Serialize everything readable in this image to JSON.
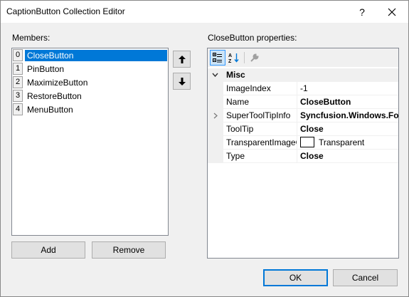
{
  "window": {
    "title": "CaptionButton Collection Editor",
    "help_glyph": "?"
  },
  "members": {
    "label": "Members:",
    "items": [
      {
        "index": "0",
        "name": "CloseButton",
        "selected": true
      },
      {
        "index": "1",
        "name": "PinButton"
      },
      {
        "index": "2",
        "name": "MaximizeButton"
      },
      {
        "index": "3",
        "name": "RestoreButton"
      },
      {
        "index": "4",
        "name": "MenuButton"
      }
    ],
    "add_label": "Add",
    "remove_label": "Remove"
  },
  "properties": {
    "label": "CloseButton properties:",
    "category": "Misc",
    "rows": [
      {
        "name": "ImageIndex",
        "value": "-1",
        "bold": false
      },
      {
        "name": "Name",
        "value": "CloseButton",
        "bold": true
      },
      {
        "name": "SuperToolTipInfo",
        "value": "Syncfusion.Windows.Forms.",
        "bold": true,
        "expandable": true
      },
      {
        "name": "ToolTip",
        "value": "Close",
        "bold": true
      },
      {
        "name": "TransparentImageColor",
        "value": "Transparent",
        "bold": false,
        "color_swatch": "#ffffff"
      },
      {
        "name": "Type",
        "value": "Close",
        "bold": true
      }
    ]
  },
  "footer": {
    "ok_label": "OK",
    "cancel_label": "Cancel"
  },
  "colors": {
    "selection": "#0078d7",
    "dialog_bg": "#f0f0f0"
  }
}
